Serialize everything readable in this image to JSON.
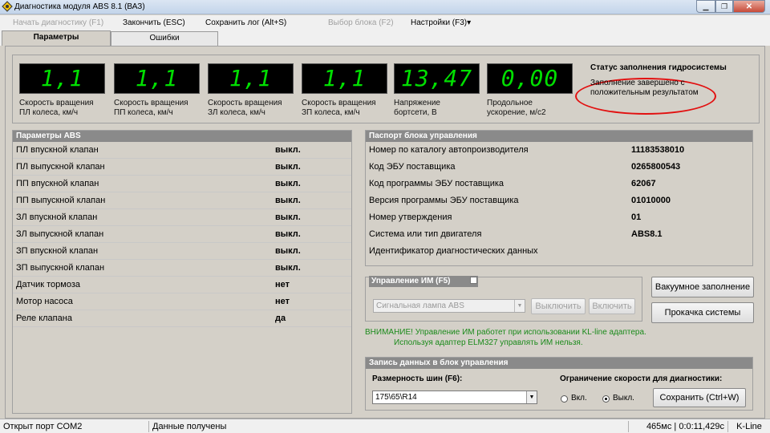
{
  "window": {
    "title": "Диагностика модуля ABS 8.1 (ВАЗ)"
  },
  "menu": {
    "start": "Начать диагностику (F1)",
    "finish": "Закончить (ESC)",
    "save_log": "Сохранить лог (Alt+S)",
    "select_block": "Выбор блока (F2)",
    "settings": "Настройки (F3)▾"
  },
  "tabs": {
    "params": "Параметры",
    "errors": "Ошибки"
  },
  "gauges": [
    {
      "value": "1,1",
      "label1": "Скорость вращения",
      "label2": "ПЛ колеса, км/ч"
    },
    {
      "value": "1,1",
      "label1": "Скорость вращения",
      "label2": "ПП колеса, км/ч"
    },
    {
      "value": "1,1",
      "label1": "Скорость вращения",
      "label2": "ЗЛ колеса, км/ч"
    },
    {
      "value": "1,1",
      "label1": "Скорость вращения",
      "label2": "ЗП колеса, км/ч"
    },
    {
      "value": "13,47",
      "label1": "Напряжение",
      "label2": "бортсети, В"
    },
    {
      "value": "0,00",
      "label1": "Продольное",
      "label2": "ускорение, м/с2"
    }
  ],
  "hydro": {
    "title": "Статус заполнения гидросистемы",
    "status": "Заполнение завершено с положительным результатом"
  },
  "abs_params": {
    "title": "Параметры ABS",
    "rows": [
      {
        "label": "ПЛ впускной клапан",
        "value": "выкл."
      },
      {
        "label": "ПЛ выпускной клапан",
        "value": "выкл."
      },
      {
        "label": "ПП впускной клапан",
        "value": "выкл."
      },
      {
        "label": "ПП выпускной клапан",
        "value": "выкл."
      },
      {
        "label": "ЗЛ впускной клапан",
        "value": "выкл."
      },
      {
        "label": "ЗЛ выпускной клапан",
        "value": "выкл."
      },
      {
        "label": "ЗП впускной клапан",
        "value": "выкл."
      },
      {
        "label": "ЗП выпускной клапан",
        "value": "выкл."
      },
      {
        "label": "Датчик тормоза",
        "value": "нет"
      },
      {
        "label": "Мотор насоса",
        "value": "нет"
      },
      {
        "label": "Реле клапана",
        "value": "да"
      }
    ]
  },
  "passport": {
    "title": "Паспорт блока управления",
    "rows": [
      {
        "label": "Номер по каталогу автопроизводителя",
        "value": "11183538010"
      },
      {
        "label": "Код ЭБУ поставщика",
        "value": "0265800543"
      },
      {
        "label": "Код программы ЭБУ поставщика",
        "value": "62067"
      },
      {
        "label": "Версия программы ЭБУ поставщика",
        "value": "01010000"
      },
      {
        "label": "Номер утверждения",
        "value": "01"
      },
      {
        "label": "Система или тип двигателя",
        "value": "ABS8.1"
      },
      {
        "label": "Идентификатор диагностических данных",
        "value": ""
      }
    ]
  },
  "im_control": {
    "title": "Управление ИМ (F5)",
    "select_value": "Сигнальная лампа ABS",
    "off_label": "Выключить",
    "on_label": "Включить"
  },
  "side_buttons": {
    "vacuum": "Вакуумное заполнение",
    "bleed": "Прокачка системы"
  },
  "warning": {
    "line1": "ВНИМАНИЕ! Управление ИМ работет при использовании KL-line адаптера.",
    "line2": "Используя адаптер ELM327 управлять ИМ нельзя."
  },
  "record": {
    "title": "Запись данных в блок управления",
    "tire_label": "Размерность шин (F6):",
    "tire_value": "175\\65\\R14",
    "speed_label": "Ограничение скорости для диагностики:",
    "on_label": "Вкл.",
    "off_label": "Выкл.",
    "selected": "off",
    "save_label": "Сохранить  (Ctrl+W)"
  },
  "status": {
    "port": "Открыт порт COM2",
    "data": "Данные получены",
    "timing": "465мс | 0:0:11,429с",
    "protocol": "K-Line"
  }
}
